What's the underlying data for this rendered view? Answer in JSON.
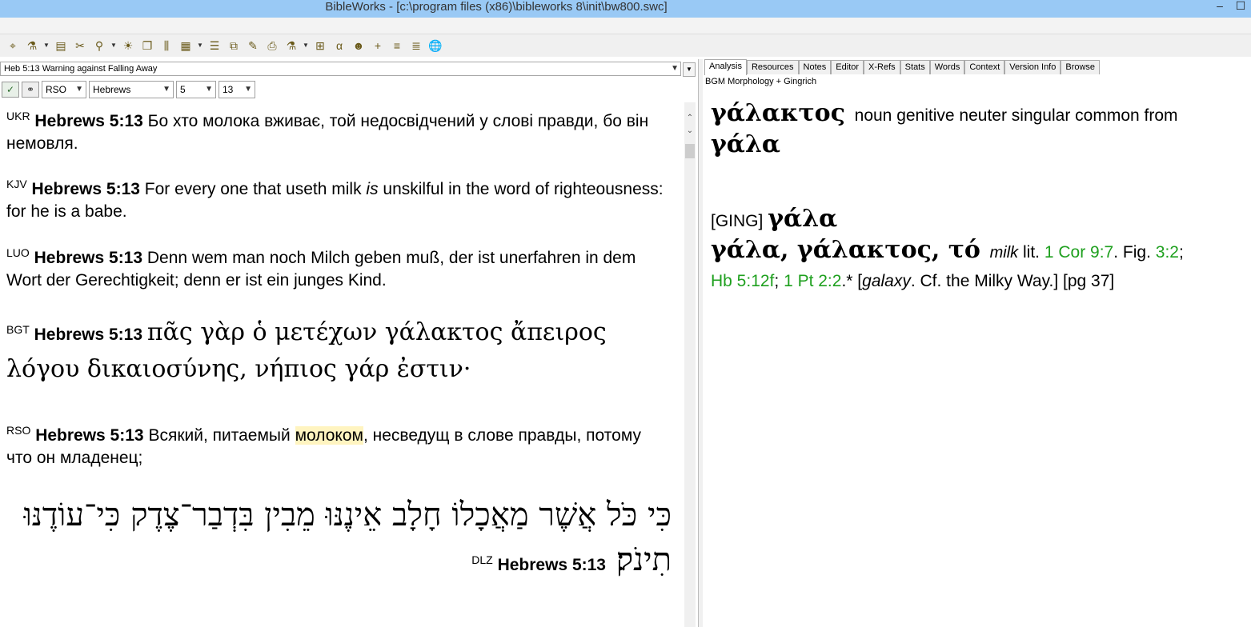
{
  "window": {
    "title": "BibleWorks - [c:\\program files (x86)\\bibleworks 8\\init\\bw800.swc]"
  },
  "verse_bar": {
    "text": "Heb 5:13 Warning against Falling Away"
  },
  "selectors": {
    "version": "RSO",
    "book": "Hebrews",
    "chapter": "5",
    "verse": "13"
  },
  "verses": [
    {
      "version": "UKR",
      "ref": "Hebrews 5:13",
      "text": "Бо хто молока вживає, той недосвідчений у слові правди, бо він немовля."
    },
    {
      "version": "KJV",
      "ref": "Hebrews 5:13",
      "text_before": "For every one that useth milk ",
      "italic": "is",
      "text_after": " unskilful in the word of righteousness: for he is a babe."
    },
    {
      "version": "LUO",
      "ref": "Hebrews 5:13",
      "text": "Denn wem man noch Milch geben muß, der ist unerfahren in dem Wort der Gerechtigkeit; denn er ist ein junges Kind."
    },
    {
      "version": "BGT",
      "ref": "Hebrews 5:13",
      "text": "πᾶς γὰρ ὁ μετέχων γάλακτος ἄπειρος λόγου δικαιοσύνης, νήπιος γάρ ἐστιν·"
    },
    {
      "version": "RSO",
      "ref": "Hebrews 5:13",
      "text_before": "Всякий, питаемый ",
      "highlight": "молоком",
      "text_after": ", несведущ в слове правды, потому что он младенец;"
    },
    {
      "version": "DLZ",
      "ref": "Hebrews 5:13",
      "text": "כִּי כֹּל אֲשֶׁר מַאֲכָלוֹ חָלָב אֵינֶנּוּ מֵבִין בִּדְבַר־צֶדֶק כִּי־עוֹדֶנּוּ תִינֹק׃"
    }
  ],
  "tabs": [
    "Analysis",
    "Resources",
    "Notes",
    "Editor",
    "X-Refs",
    "Stats",
    "Words",
    "Context",
    "Version Info",
    "Browse"
  ],
  "analysis": {
    "subtitle": "BGM Morphology + Gingrich",
    "word": "γάλακτος",
    "parse": "noun genitive neuter singular common from",
    "lemma": "γάλα",
    "ging_tag": "[GING]",
    "ging_word": "γάλα",
    "entry_forms": "γάλα, γάλακτος, τό",
    "gloss": "milk",
    "lit": "lit.",
    "ref1": "1 Cor 9:7",
    "fig": ". Fig.",
    "ref2": "3:2",
    "ref3": "Hb 5:12f",
    "ref4": "1 Pt 2:2",
    "star": ".* [",
    "galaxy": "galaxy",
    "closing": ". Cf. the Milky Way.] [pg 37]"
  }
}
